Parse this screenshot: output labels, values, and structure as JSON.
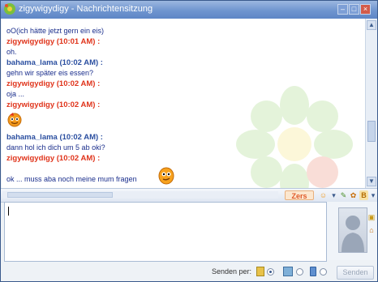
{
  "window": {
    "title": "zigywigydigy - Nachrichtensitzung",
    "minimize": "–",
    "maximize": "□",
    "close": "×"
  },
  "history": {
    "lines": [
      {
        "kind": "msg",
        "text": "oO(ich hätte jetzt gern ein eis)"
      },
      {
        "kind": "sender",
        "color": "red",
        "text": "zigywigydigy (10:01 AM) :"
      },
      {
        "kind": "msg",
        "text": "oh."
      },
      {
        "kind": "sender",
        "color": "blue",
        "text": "bahama_lama (10:02 AM) :"
      },
      {
        "kind": "msg",
        "text": "gehn wir später eis essen?"
      },
      {
        "kind": "sender",
        "color": "red",
        "text": "zigywigydigy (10:02 AM) :"
      },
      {
        "kind": "msg",
        "text": "oja ..."
      },
      {
        "kind": "sender",
        "color": "red",
        "text": "zigywigydigy (10:02 AM) :"
      },
      {
        "kind": "sender",
        "color": "blue",
        "text": "bahama_lama (10:02 AM) :"
      },
      {
        "kind": "msg",
        "text": "dann hol ich dich um 5 ab oki?"
      },
      {
        "kind": "sender",
        "color": "red",
        "text": "zigywigydigy (10:02 AM) :"
      },
      {
        "kind": "msg",
        "text": "ok ... muss aba noch meine mum fragen"
      }
    ]
  },
  "toolbar": {
    "zers_label": "Zers",
    "bold_label": "B"
  },
  "input": {
    "value": ""
  },
  "bottombar": {
    "send_per_label": "Senden per:",
    "send_button": "Senden"
  },
  "colors": {
    "red_sender": "#e0341b",
    "blue_sender": "#2b4fa0",
    "message_text": "#1a2e8c",
    "titlebar": "#6f95cf"
  }
}
